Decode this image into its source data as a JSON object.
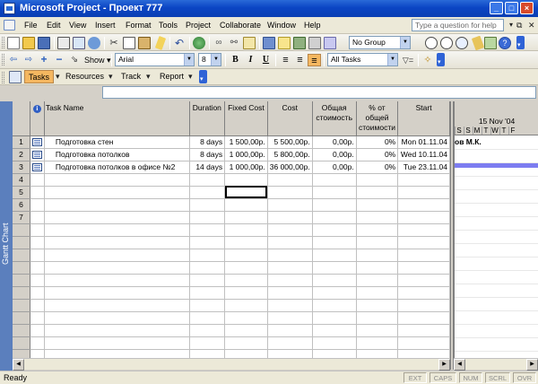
{
  "window": {
    "title": "Microsoft Project - Проект 777",
    "minimize": "_",
    "maximize": "□",
    "close": "×"
  },
  "menu": {
    "items": [
      "File",
      "Edit",
      "View",
      "Insert",
      "Format",
      "Tools",
      "Project",
      "Collaborate",
      "Window",
      "Help"
    ],
    "help_placeholder": "Type a question for help"
  },
  "standard_toolbar": {
    "group_combo": "No Group"
  },
  "formatting_toolbar": {
    "show_label": "Show",
    "font": "Arial",
    "font_size": "8",
    "bold": "B",
    "italic": "I",
    "underline": "U",
    "filter": "All Tasks"
  },
  "view_toolbar": {
    "tasks": "Tasks",
    "resources": "Resources",
    "track": "Track",
    "report": "Report"
  },
  "side_label": "Gantt Chart",
  "table": {
    "headers": [
      "Task Name",
      "Duration",
      "Fixed Cost",
      "Cost",
      "Общая стоимость",
      "% от общей стоимости",
      "Start"
    ],
    "info_glyph": "i",
    "rows": [
      {
        "id": "1",
        "name": "Подготовка стен",
        "duration": "8 days",
        "fixed_cost": "1 500,00р.",
        "cost": "5 500,00р.",
        "total": "0,00р.",
        "pct": "0%",
        "start": "Mon 01.11.04"
      },
      {
        "id": "2",
        "name": "Подготовка потолков",
        "duration": "8 days",
        "fixed_cost": "1 000,00р.",
        "cost": "5 800,00р.",
        "total": "0,00р.",
        "pct": "0%",
        "start": "Wed 10.11.04"
      },
      {
        "id": "3",
        "name": "Подготовка потолков в офисе №2",
        "duration": "14 days",
        "fixed_cost": "1 000,00р.",
        "cost": "36 000,00р.",
        "total": "0,00р.",
        "pct": "0%",
        "start": "Tue 23.11.04"
      }
    ],
    "empty_row_ids": [
      "4",
      "5",
      "6",
      "7"
    ]
  },
  "gantt": {
    "week": "15 Nov '04",
    "days": [
      "S",
      "S",
      "M",
      "T",
      "W",
      "T",
      "F"
    ],
    "bar_label": "ов М.К."
  },
  "status": {
    "text": "Ready",
    "indicators": [
      "EXT",
      "CAPS",
      "NUM",
      "SCRL",
      "OVR"
    ]
  },
  "colors": {
    "title_bar": "#0b45c4",
    "view_label": "#5b7fbd",
    "gantt_selection": "#7d7df0"
  }
}
